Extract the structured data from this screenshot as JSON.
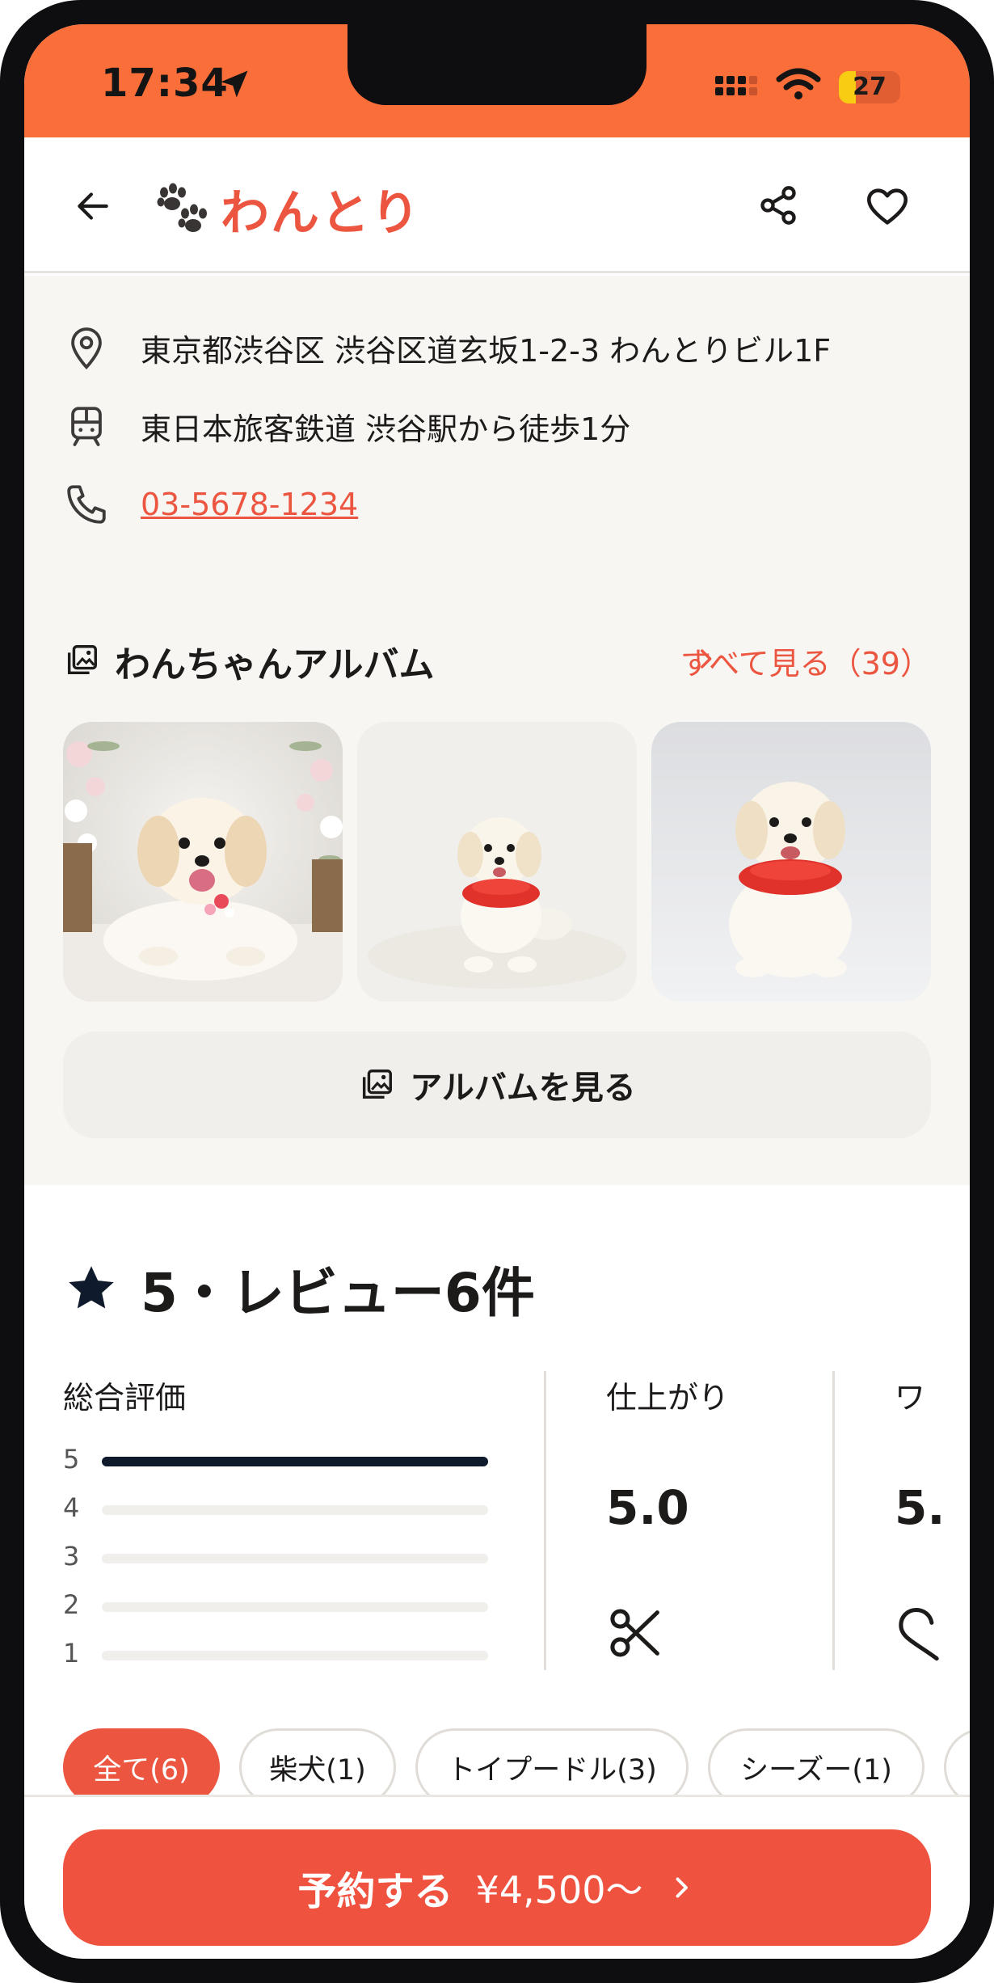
{
  "status_bar": {
    "time": "17:34",
    "battery_level": "27",
    "battery_fraction": 0.27,
    "icons": [
      "location-arrow-icon",
      "signal-icon",
      "wifi-icon",
      "battery-icon"
    ]
  },
  "header": {
    "brand": "わんとり",
    "icons": [
      "back-arrow-icon",
      "paw-icon",
      "share-icon",
      "heart-icon"
    ]
  },
  "info": {
    "address": "東京都渋谷区 渋谷区道玄坂1-2-3 わんとりビル1F",
    "access": "東日本旅客鉄道 渋谷駅から徒歩1分",
    "phone": "03-5678-1234",
    "icons": [
      "map-pin-icon",
      "train-icon",
      "phone-icon"
    ]
  },
  "album": {
    "title": "わんちゃんアルバム",
    "see_all": "すべて見る（39）",
    "button": "アルバムを見る",
    "photos": [
      "dog-photo-flowers",
      "dog-photo-red-collar",
      "dog-photo-red-collar-gray"
    ]
  },
  "reviews": {
    "title": "5・レビュー6件",
    "overall_label": "総合評価",
    "distribution": [
      {
        "star": "5",
        "fraction": 1.0
      },
      {
        "star": "4",
        "fraction": 0.0
      },
      {
        "star": "3",
        "fraction": 0.0
      },
      {
        "star": "2",
        "fraction": 0.0
      },
      {
        "star": "1",
        "fraction": 0.0
      }
    ],
    "metrics": [
      {
        "label": "仕上がり",
        "value": "5.0",
        "icon": "scissors-icon"
      },
      {
        "label": "ワ",
        "value": "5.",
        "icon": "hook-icon"
      }
    ],
    "filters": [
      "全て(6)",
      "柴犬(1)",
      "トイプードル(3)",
      "シーズー(1)",
      ""
    ]
  },
  "footer": {
    "cta_label": "予約する",
    "cta_price": "¥4,500〜"
  },
  "colors": {
    "accent": "#ec5641",
    "status_bar": "#fa6e39",
    "star": "#0f1a2c"
  }
}
